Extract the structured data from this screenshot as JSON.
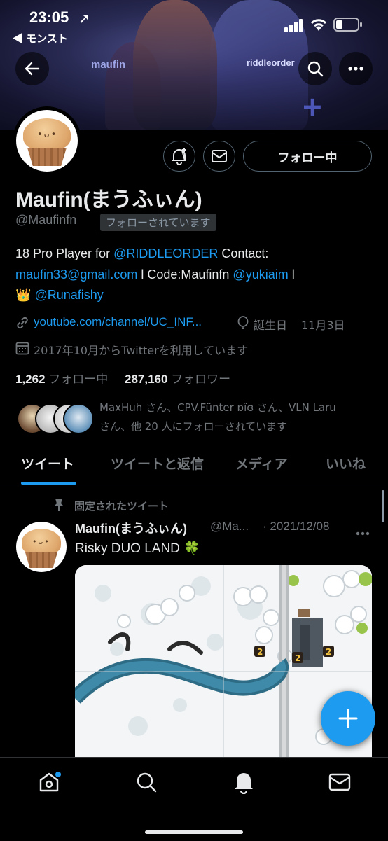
{
  "status_bar": {
    "time": "23:05",
    "back_app": "◀ モンスト"
  },
  "banner": {
    "left_text": "maufin",
    "right_text": "riddleorder"
  },
  "profile": {
    "name": "Maufin(まうふぃん)",
    "handle": "@Maufinfn",
    "follows_you": "フォローされています",
    "following_button": "フォロー中",
    "bio_line1_a": "18 Pro Player for ",
    "bio_line1_link": "@RIDDLEORDER",
    "bio_line1_b": " Contact:",
    "bio_line2_link1": "maufin33@gmail.com",
    "bio_line2_mid": " l Code:Maufinfn ",
    "bio_line2_link2": "@yukiaim",
    "bio_line2_end": " l",
    "bio_line3_emoji": "👑",
    "bio_line3_link": "@Runafishy",
    "website": "youtube.com/channel/UC_INF...",
    "birthday_label": "誕生日",
    "birthday": "11月3日",
    "joined": "2017年10月からTwitterを利用しています",
    "following_count": "1,262",
    "following_label": "フォロー中",
    "followers_count": "287,160",
    "followers_label": "フォロワー",
    "followed_by_line1": "MaxHuh さん、CPV.Fünter ɒïɞ さん、VLN Laru",
    "followed_by_line2": "さん、他 20 人にフォローされています"
  },
  "tabs": [
    "ツイート",
    "ツイートと返信",
    "メディア",
    "いいね"
  ],
  "pinned_tweet": {
    "pinned_label": "固定されたツイート",
    "author": "Maufin(まうふぃん)",
    "handle": "@Ma...",
    "date": "· 2021/12/08",
    "text": "Risky DUO LAND 🍀"
  },
  "colors": {
    "accent": "#1d9bf0",
    "background": "#000000",
    "muted": "#71767b"
  },
  "icons": [
    "back-arrow-icon",
    "search-icon",
    "more-icon",
    "notification-bell-icon",
    "mail-icon",
    "link-icon",
    "balloon-icon",
    "calendar-icon",
    "pin-icon",
    "home-icon",
    "search-nav-icon",
    "bell-nav-icon",
    "mail-nav-icon",
    "compose-plus-icon"
  ]
}
